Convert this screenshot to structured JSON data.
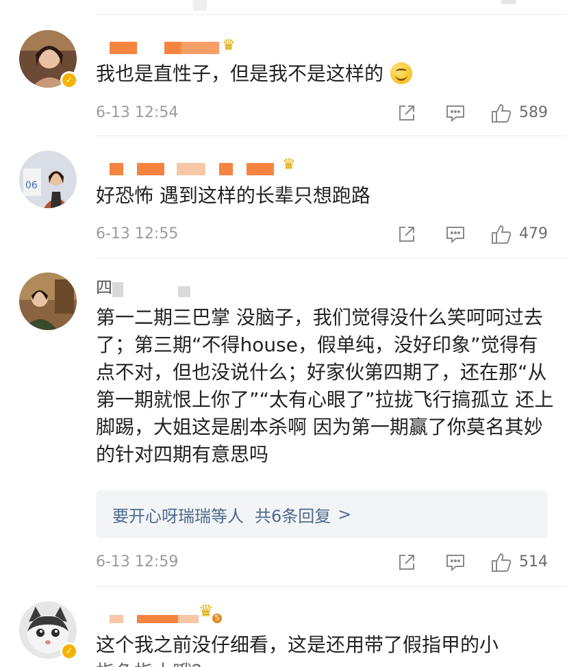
{
  "comments": [
    {
      "text": "我也是直性子，但是我不是这样的",
      "time": "6-13 12:54",
      "likes": "589"
    },
    {
      "text": "好恐怖 遇到这样的长辈只想跑路",
      "time": "6-13 12:55",
      "likes": "479"
    },
    {
      "name_fragment": "四",
      "text": "第一二期三巴掌 没脑子，我们觉得没什么笑呵呵过去了；第三期“不得house，假单纯，没好印象”觉得有点不对，但也没说什么；好家伙第四期了，还在那“从第一期就恨上你了”“太有心眼了”拉拢飞行搞孤立 还上脚踢，大姐这是剧本杀啊 因为第一期赢了你莫名其妙的针对四期有意思吗",
      "replies": {
        "users": "要开心呀瑞瑞等人",
        "total": "共6条回复",
        "chevron": ">"
      },
      "time": "6-13 12:59",
      "likes": "514"
    },
    {
      "badge_level": "5",
      "text": "这个我之前没仔细看，这是还用带了假指甲的小",
      "text_line2": "指色指木哦？"
    }
  ],
  "icons": {
    "share": "share-icon",
    "reply": "comment-icon",
    "like": "thumbs-up-icon",
    "verified": "verified-badge-icon"
  },
  "colors": {
    "name_highlight": "#f58440",
    "link_blue": "#4d6a8f",
    "meta_gray": "#9b9b9b",
    "verified_gold": "#f5b300"
  }
}
